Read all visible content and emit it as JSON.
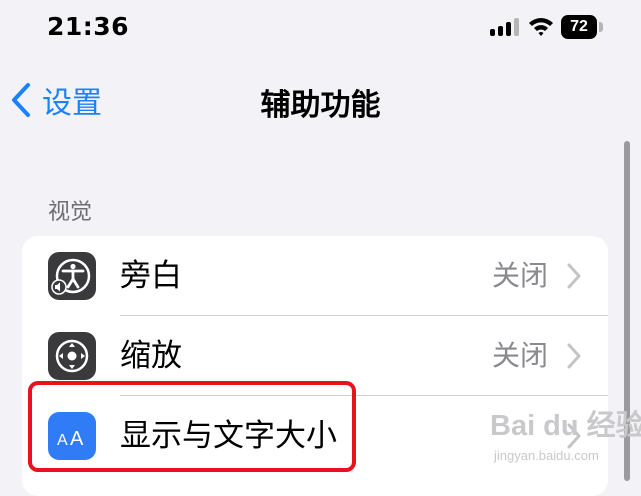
{
  "status_bar": {
    "time": "21:36",
    "battery_level": "72",
    "icons": [
      "cellular-signal-icon",
      "wifi-icon",
      "battery-icon"
    ]
  },
  "nav": {
    "back_label": "设置",
    "title": "辅助功能"
  },
  "section": {
    "header": "视觉",
    "rows": [
      {
        "label": "旁白",
        "value": "关闭",
        "icon": "voiceover-icon"
      },
      {
        "label": "缩放",
        "value": "关闭",
        "icon": "zoom-icon"
      },
      {
        "label": "显示与文字大小",
        "value": "",
        "icon": "text-size-icon"
      }
    ]
  },
  "watermark": {
    "logo_text": "Bai du 经验",
    "url": "jingyan.baidu.com"
  },
  "colors": {
    "accent": "#1a82fb",
    "background": "#f2f2f7",
    "highlight": "#e8121e",
    "text_size_icon": "#2f7cf6"
  }
}
